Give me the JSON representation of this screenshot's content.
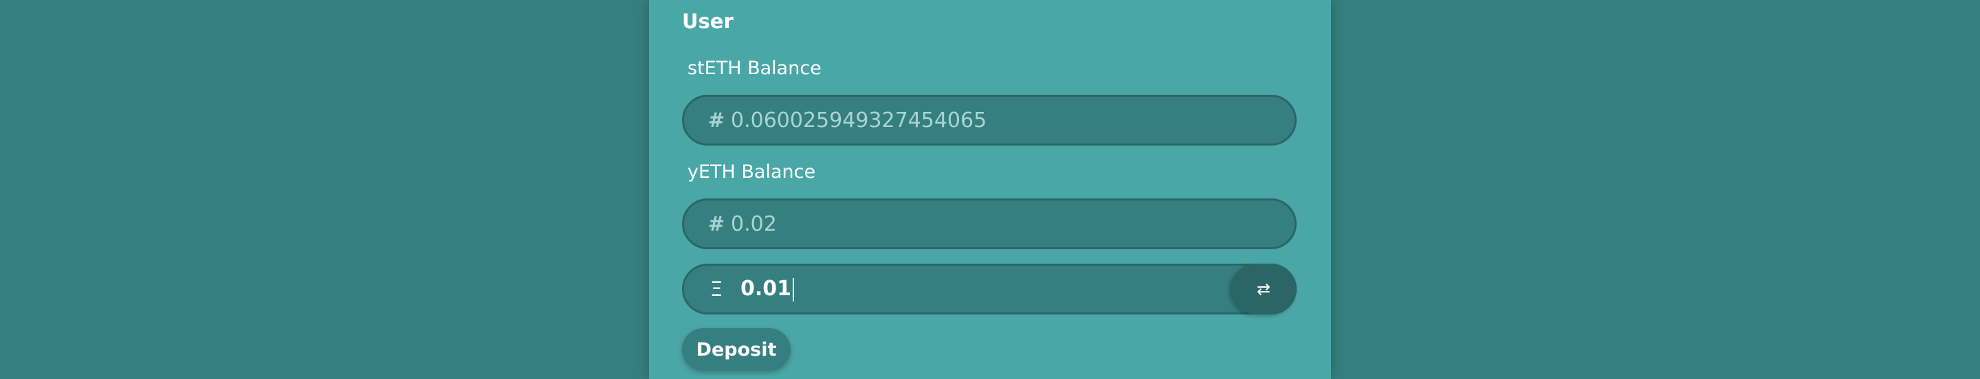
{
  "user": {
    "title": "User",
    "steth": {
      "label": "stETH Balance",
      "prefix": "#",
      "value": "0.060025949327454065"
    },
    "yeth": {
      "label": "yETH Balance",
      "prefix": "#",
      "value": "0.02"
    },
    "amount": {
      "prefix": "Ξ",
      "value": "0.01"
    },
    "swap_icon": "swap-arrows-icon",
    "swap_glyph": "⇄",
    "deposit_label": "Deposit"
  },
  "colors": {
    "background": "#367f80",
    "panel": "#4aa7a8",
    "field": "#367f80",
    "field_border": "#2b6667"
  }
}
